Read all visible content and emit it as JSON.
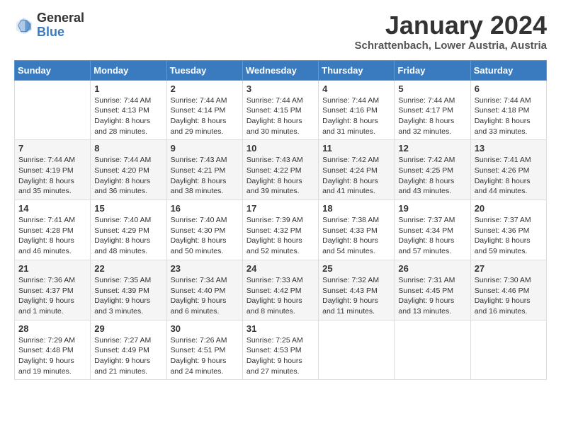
{
  "header": {
    "logo": {
      "text_general": "General",
      "text_blue": "Blue",
      "icon_alt": "GeneralBlue logo"
    },
    "title": "January 2024",
    "subtitle": "Schrattenbach, Lower Austria, Austria"
  },
  "calendar": {
    "days_of_week": [
      "Sunday",
      "Monday",
      "Tuesday",
      "Wednesday",
      "Thursday",
      "Friday",
      "Saturday"
    ],
    "weeks": [
      [
        {
          "day": "",
          "sunrise": "",
          "sunset": "",
          "daylight": ""
        },
        {
          "day": "1",
          "sunrise": "Sunrise: 7:44 AM",
          "sunset": "Sunset: 4:13 PM",
          "daylight": "Daylight: 8 hours and 28 minutes."
        },
        {
          "day": "2",
          "sunrise": "Sunrise: 7:44 AM",
          "sunset": "Sunset: 4:14 PM",
          "daylight": "Daylight: 8 hours and 29 minutes."
        },
        {
          "day": "3",
          "sunrise": "Sunrise: 7:44 AM",
          "sunset": "Sunset: 4:15 PM",
          "daylight": "Daylight: 8 hours and 30 minutes."
        },
        {
          "day": "4",
          "sunrise": "Sunrise: 7:44 AM",
          "sunset": "Sunset: 4:16 PM",
          "daylight": "Daylight: 8 hours and 31 minutes."
        },
        {
          "day": "5",
          "sunrise": "Sunrise: 7:44 AM",
          "sunset": "Sunset: 4:17 PM",
          "daylight": "Daylight: 8 hours and 32 minutes."
        },
        {
          "day": "6",
          "sunrise": "Sunrise: 7:44 AM",
          "sunset": "Sunset: 4:18 PM",
          "daylight": "Daylight: 8 hours and 33 minutes."
        }
      ],
      [
        {
          "day": "7",
          "sunrise": "Sunrise: 7:44 AM",
          "sunset": "Sunset: 4:19 PM",
          "daylight": "Daylight: 8 hours and 35 minutes."
        },
        {
          "day": "8",
          "sunrise": "Sunrise: 7:44 AM",
          "sunset": "Sunset: 4:20 PM",
          "daylight": "Daylight: 8 hours and 36 minutes."
        },
        {
          "day": "9",
          "sunrise": "Sunrise: 7:43 AM",
          "sunset": "Sunset: 4:21 PM",
          "daylight": "Daylight: 8 hours and 38 minutes."
        },
        {
          "day": "10",
          "sunrise": "Sunrise: 7:43 AM",
          "sunset": "Sunset: 4:22 PM",
          "daylight": "Daylight: 8 hours and 39 minutes."
        },
        {
          "day": "11",
          "sunrise": "Sunrise: 7:42 AM",
          "sunset": "Sunset: 4:24 PM",
          "daylight": "Daylight: 8 hours and 41 minutes."
        },
        {
          "day": "12",
          "sunrise": "Sunrise: 7:42 AM",
          "sunset": "Sunset: 4:25 PM",
          "daylight": "Daylight: 8 hours and 43 minutes."
        },
        {
          "day": "13",
          "sunrise": "Sunrise: 7:41 AM",
          "sunset": "Sunset: 4:26 PM",
          "daylight": "Daylight: 8 hours and 44 minutes."
        }
      ],
      [
        {
          "day": "14",
          "sunrise": "Sunrise: 7:41 AM",
          "sunset": "Sunset: 4:28 PM",
          "daylight": "Daylight: 8 hours and 46 minutes."
        },
        {
          "day": "15",
          "sunrise": "Sunrise: 7:40 AM",
          "sunset": "Sunset: 4:29 PM",
          "daylight": "Daylight: 8 hours and 48 minutes."
        },
        {
          "day": "16",
          "sunrise": "Sunrise: 7:40 AM",
          "sunset": "Sunset: 4:30 PM",
          "daylight": "Daylight: 8 hours and 50 minutes."
        },
        {
          "day": "17",
          "sunrise": "Sunrise: 7:39 AM",
          "sunset": "Sunset: 4:32 PM",
          "daylight": "Daylight: 8 hours and 52 minutes."
        },
        {
          "day": "18",
          "sunrise": "Sunrise: 7:38 AM",
          "sunset": "Sunset: 4:33 PM",
          "daylight": "Daylight: 8 hours and 54 minutes."
        },
        {
          "day": "19",
          "sunrise": "Sunrise: 7:37 AM",
          "sunset": "Sunset: 4:34 PM",
          "daylight": "Daylight: 8 hours and 57 minutes."
        },
        {
          "day": "20",
          "sunrise": "Sunrise: 7:37 AM",
          "sunset": "Sunset: 4:36 PM",
          "daylight": "Daylight: 8 hours and 59 minutes."
        }
      ],
      [
        {
          "day": "21",
          "sunrise": "Sunrise: 7:36 AM",
          "sunset": "Sunset: 4:37 PM",
          "daylight": "Daylight: 9 hours and 1 minute."
        },
        {
          "day": "22",
          "sunrise": "Sunrise: 7:35 AM",
          "sunset": "Sunset: 4:39 PM",
          "daylight": "Daylight: 9 hours and 3 minutes."
        },
        {
          "day": "23",
          "sunrise": "Sunrise: 7:34 AM",
          "sunset": "Sunset: 4:40 PM",
          "daylight": "Daylight: 9 hours and 6 minutes."
        },
        {
          "day": "24",
          "sunrise": "Sunrise: 7:33 AM",
          "sunset": "Sunset: 4:42 PM",
          "daylight": "Daylight: 9 hours and 8 minutes."
        },
        {
          "day": "25",
          "sunrise": "Sunrise: 7:32 AM",
          "sunset": "Sunset: 4:43 PM",
          "daylight": "Daylight: 9 hours and 11 minutes."
        },
        {
          "day": "26",
          "sunrise": "Sunrise: 7:31 AM",
          "sunset": "Sunset: 4:45 PM",
          "daylight": "Daylight: 9 hours and 13 minutes."
        },
        {
          "day": "27",
          "sunrise": "Sunrise: 7:30 AM",
          "sunset": "Sunset: 4:46 PM",
          "daylight": "Daylight: 9 hours and 16 minutes."
        }
      ],
      [
        {
          "day": "28",
          "sunrise": "Sunrise: 7:29 AM",
          "sunset": "Sunset: 4:48 PM",
          "daylight": "Daylight: 9 hours and 19 minutes."
        },
        {
          "day": "29",
          "sunrise": "Sunrise: 7:27 AM",
          "sunset": "Sunset: 4:49 PM",
          "daylight": "Daylight: 9 hours and 21 minutes."
        },
        {
          "day": "30",
          "sunrise": "Sunrise: 7:26 AM",
          "sunset": "Sunset: 4:51 PM",
          "daylight": "Daylight: 9 hours and 24 minutes."
        },
        {
          "day": "31",
          "sunrise": "Sunrise: 7:25 AM",
          "sunset": "Sunset: 4:53 PM",
          "daylight": "Daylight: 9 hours and 27 minutes."
        },
        {
          "day": "",
          "sunrise": "",
          "sunset": "",
          "daylight": ""
        },
        {
          "day": "",
          "sunrise": "",
          "sunset": "",
          "daylight": ""
        },
        {
          "day": "",
          "sunrise": "",
          "sunset": "",
          "daylight": ""
        }
      ]
    ]
  }
}
